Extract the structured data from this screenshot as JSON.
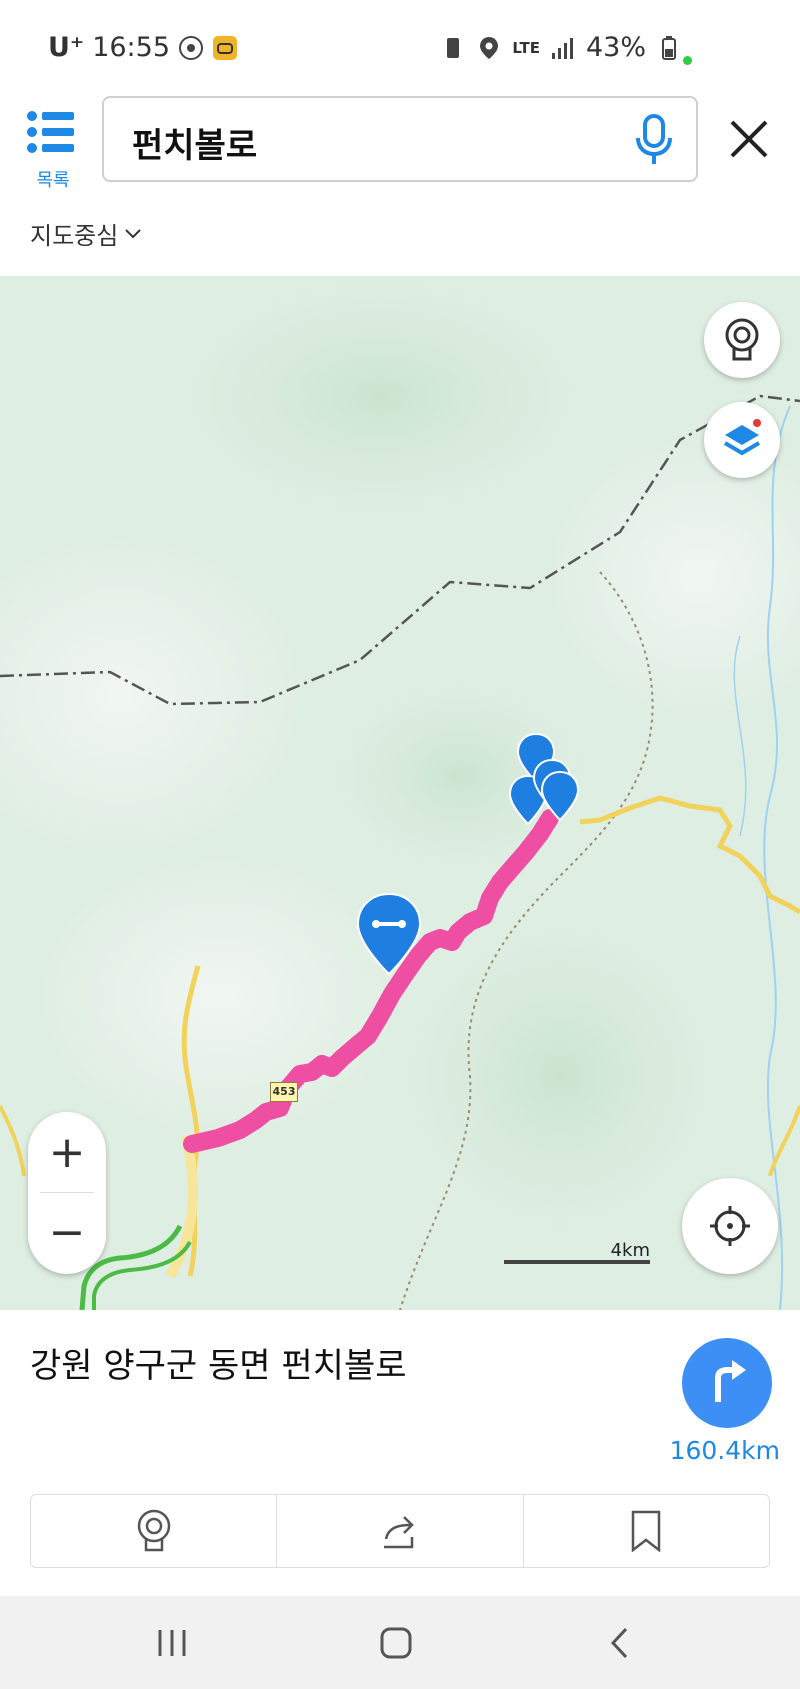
{
  "status": {
    "carrier": "U⁺",
    "time": "16:55",
    "network": "LTE",
    "battery": "43%"
  },
  "header": {
    "list_label": "목록",
    "search_value": "펀치볼로",
    "center_selector": "지도중심"
  },
  "map": {
    "route_number": "453",
    "scale_label": "4km",
    "route_color": "#ee4fa3",
    "road_color": "#f1d25a",
    "marker_color": "#1e7fe0"
  },
  "place": {
    "address": "강원 양구군 동면 펀치볼로",
    "distance": "160.4km"
  },
  "icons": {
    "menu": "list-icon",
    "mic": "microphone-icon",
    "close": "close-icon",
    "street_view": "street-view-icon",
    "layers": "layers-icon",
    "locate": "crosshair-icon",
    "navigate": "turn-right-arrow-icon",
    "share": "share-icon",
    "bookmark": "bookmark-icon"
  },
  "zoom": {
    "in": "+",
    "out": "−"
  }
}
